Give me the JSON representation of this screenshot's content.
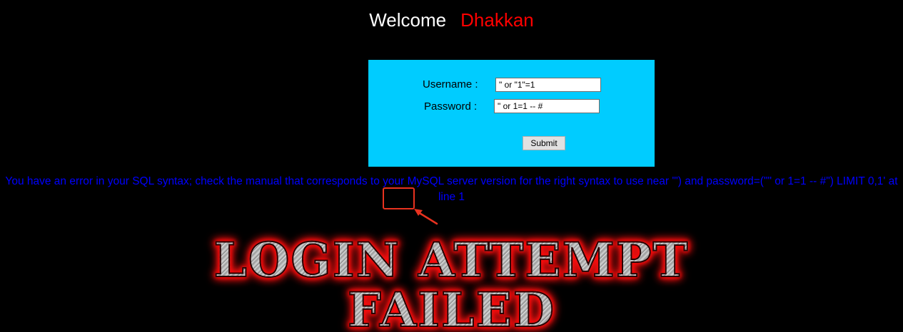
{
  "welcome": {
    "greeting": "Welcome",
    "name": "Dhakkan"
  },
  "login_form": {
    "username_label": "Username :",
    "username_value": "\" or \"1\"=1",
    "password_label": "Password :",
    "password_value": "\" or 1=1 -- #",
    "submit_label": "Submit"
  },
  "error_message": "You have an error in your SQL syntax; check the manual that corresponds to your MySQL server version for the right syntax to use near '\") and password=(\"\" or 1=1 -- #\") LIMIT 0,1' at line 1",
  "banner": {
    "line1": "LOGIN ATTEMPT",
    "line2": "FAILED"
  },
  "colors": {
    "background": "#000000",
    "form_background": "#00ccff",
    "error_text": "#0000ff",
    "name_text": "#ff0000",
    "annotation": "#e8321f"
  }
}
